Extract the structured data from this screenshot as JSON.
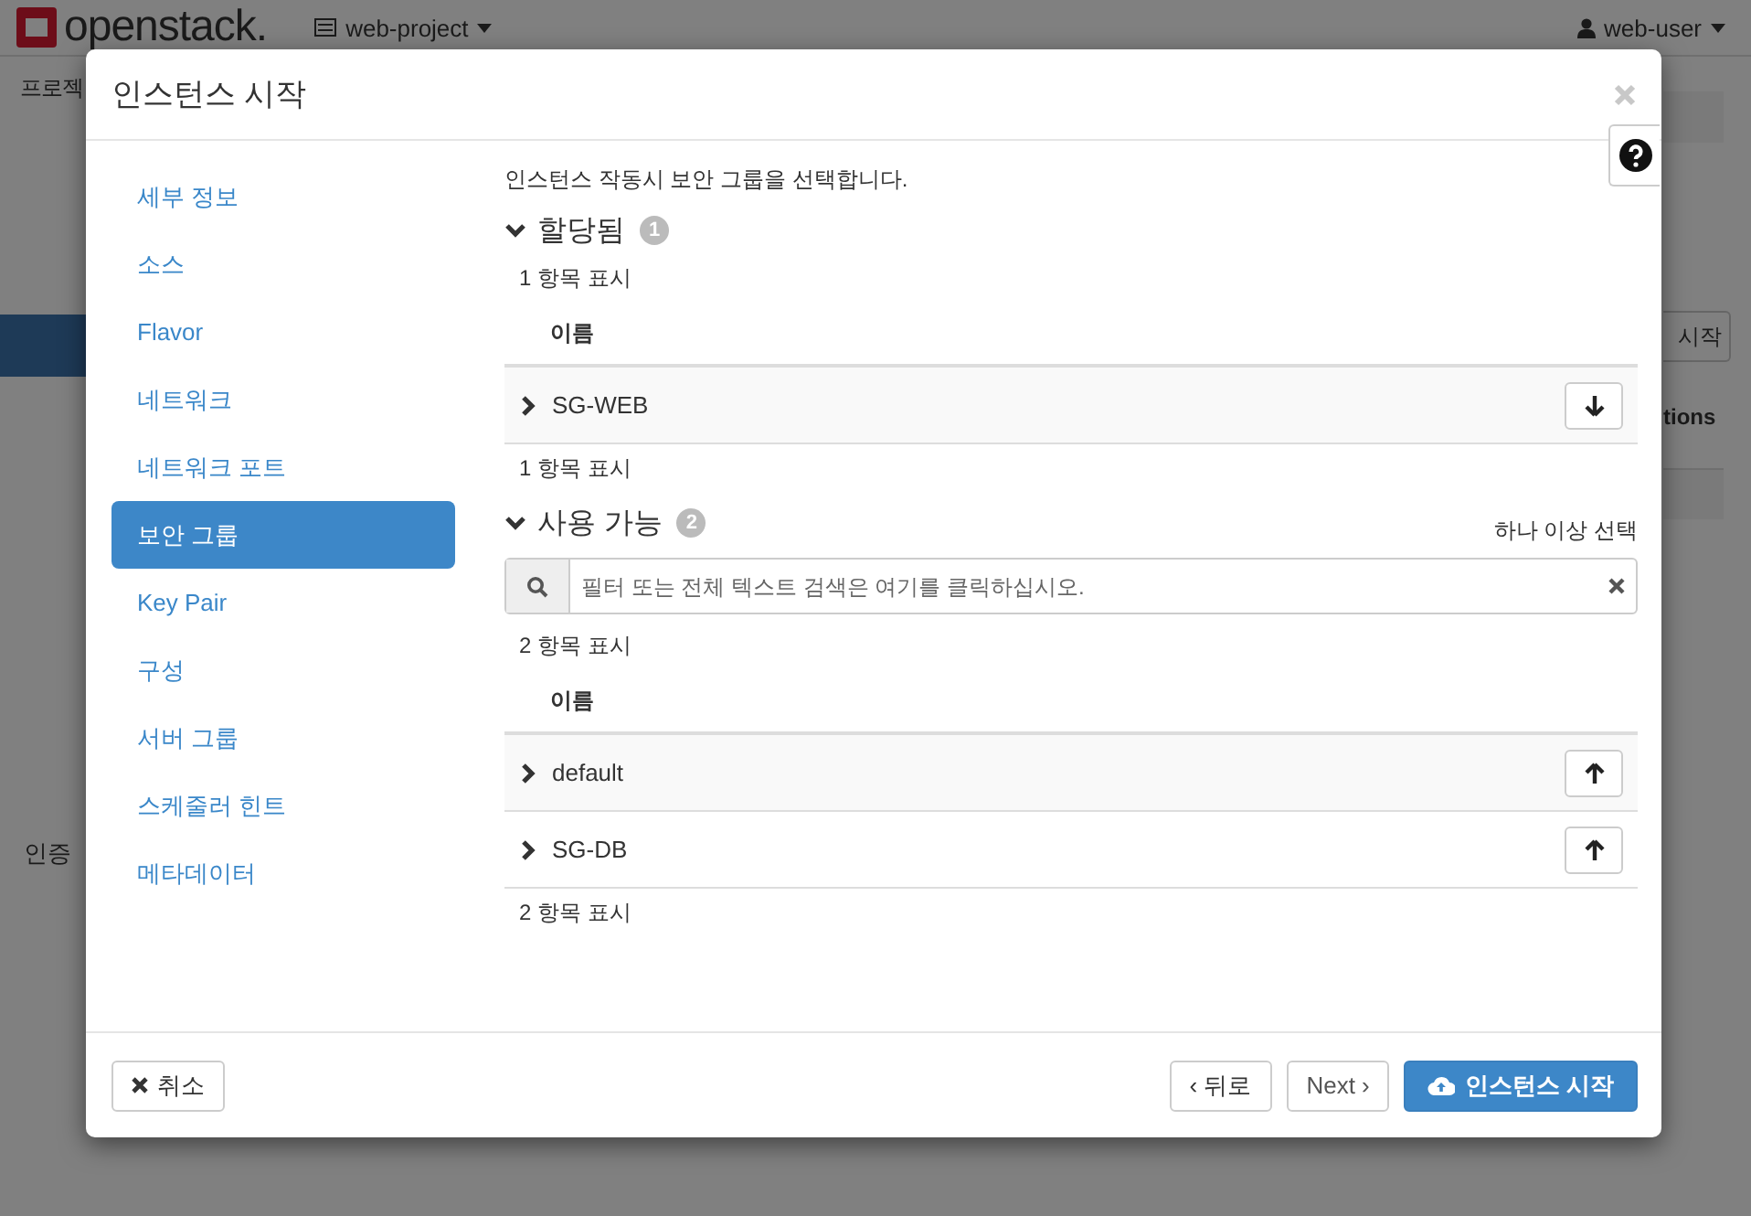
{
  "background": {
    "logo": "openstack.",
    "project": "web-project",
    "user": "web-user",
    "breadcrumb": "프로젝",
    "button_fragment": "시작",
    "column_fragment": "tions",
    "label": "인증"
  },
  "dialog": {
    "title": "인스턴스 시작",
    "steps": [
      {
        "label": "세부 정보",
        "selected": false
      },
      {
        "label": "소스",
        "selected": false
      },
      {
        "label": "Flavor",
        "selected": false
      },
      {
        "label": "네트워크",
        "selected": false
      },
      {
        "label": "네트워크 포트",
        "selected": false
      },
      {
        "label": "보안 그룹",
        "selected": true
      },
      {
        "label": "Key Pair",
        "selected": false
      },
      {
        "label": "구성",
        "selected": false
      },
      {
        "label": "서버 그룹",
        "selected": false
      },
      {
        "label": "스케줄러 힌트",
        "selected": false
      },
      {
        "label": "메타데이터",
        "selected": false
      }
    ],
    "description": "인스턴스 작동시 보안 그룹을 선택합니다.",
    "sections": [
      {
        "kind": "allocated",
        "title": "할당됨",
        "count": "1",
        "expanded": true,
        "summary_top": "1 항목 표시",
        "column": "이름",
        "rows": [
          {
            "name": "SG-WEB",
            "expanded": false
          }
        ],
        "summary_bottom": "1 항목 표시"
      },
      {
        "kind": "available",
        "title": "사용 가능",
        "count": "2",
        "expanded": true,
        "hint": "하나 이상 선택",
        "search": {
          "placeholder": "필터 또는 전체 텍스트 검색은 여기를 클릭하십시오."
        },
        "summary_top": "2 항목 표시",
        "column": "이름",
        "rows": [
          {
            "name": "default",
            "expanded": false
          },
          {
            "name": "SG-DB",
            "expanded": false
          }
        ],
        "summary_bottom": "2 항목 표시"
      }
    ],
    "footer": {
      "cancel": "취소",
      "back": "‹ 뒤로",
      "next": "Next ›",
      "launch": "인스턴스 시작"
    }
  }
}
